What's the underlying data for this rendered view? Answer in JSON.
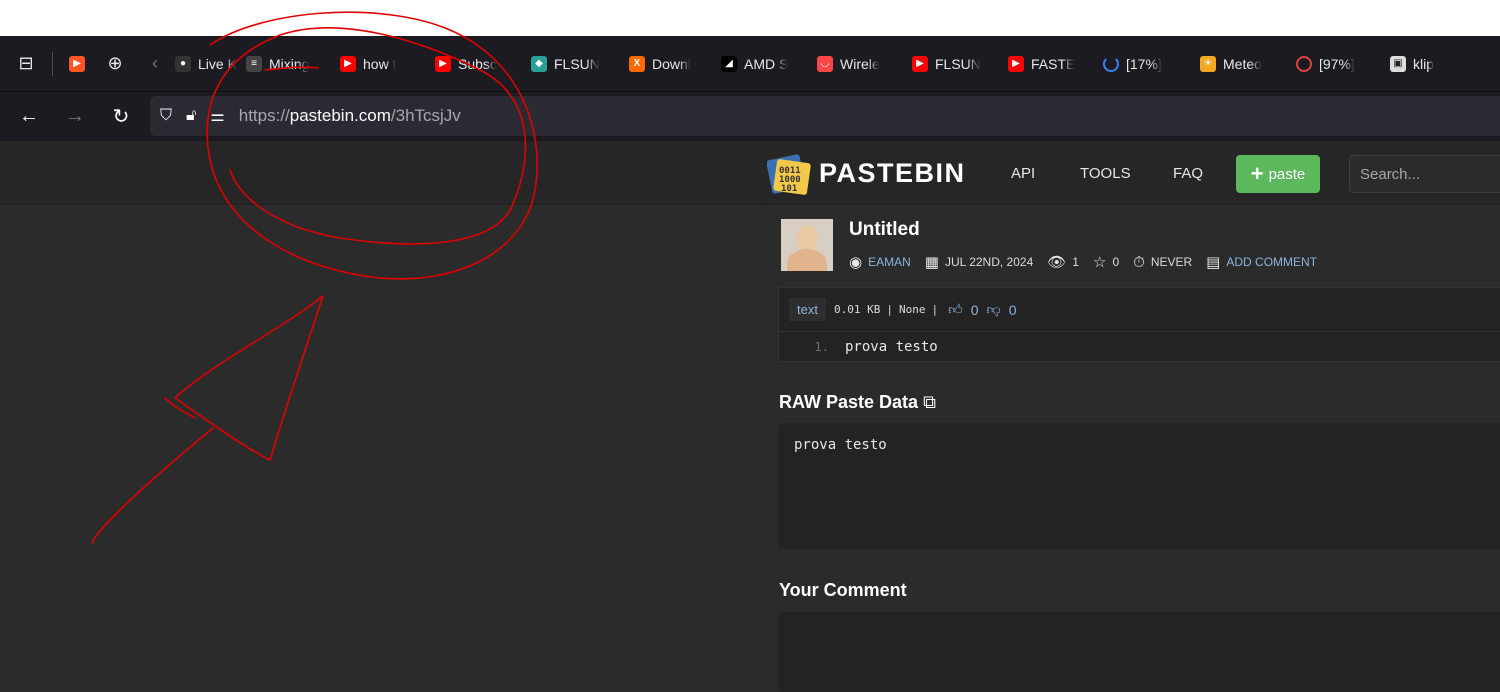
{
  "browser": {
    "tabs": [
      {
        "label": "Live K",
        "icon": "livekit-icon",
        "color": "#333333"
      },
      {
        "label": "Mixing",
        "icon": "mixing-icon",
        "color": "#444444"
      },
      {
        "label": "how t",
        "icon": "youtube-icon",
        "color": "#ff0000"
      },
      {
        "label": "Subsc",
        "icon": "youtube-icon",
        "color": "#ff0000"
      },
      {
        "label": "FLSUN",
        "icon": "flsun-icon",
        "color": "#2aa198"
      },
      {
        "label": "Downl",
        "icon": "x-icon",
        "color": "#ff6a00"
      },
      {
        "label": "AMD S",
        "icon": "amd-icon",
        "color": "#000000"
      },
      {
        "label": "Wirele",
        "icon": "aliexpress-icon",
        "color": "#ff4747"
      },
      {
        "label": "FLSUN",
        "icon": "youtube-icon",
        "color": "#ff0000"
      },
      {
        "label": "FASTE",
        "icon": "youtube-icon",
        "color": "#ff0000"
      },
      {
        "label": "[17%]",
        "icon": "loading-spinner-icon",
        "color": "#3b82f6"
      },
      {
        "label": "Meteo",
        "icon": "meteo-icon",
        "color": "#f5a623"
      },
      {
        "label": "[97%]",
        "icon": "loading-ring-icon",
        "color": "#e0433b"
      },
      {
        "label": "klip",
        "icon": "klip-icon",
        "color": "#dddddd"
      }
    ],
    "url_prefix": "https://",
    "url_domain": "pastebin.com",
    "url_path": "/3hTcsjJv"
  },
  "site": {
    "logo_text": "PASTEBIN",
    "nav": [
      "API",
      "TOOLS",
      "FAQ"
    ],
    "paste_button": "paste",
    "search_placeholder": "Search..."
  },
  "paste": {
    "title": "Untitled",
    "author": "EAMAN",
    "date": "JUL 22ND, 2024",
    "views": "1",
    "stars": "0",
    "expiry": "NEVER",
    "add_comment": "ADD COMMENT",
    "syntax": "text",
    "size": "0.01 KB",
    "category": "None",
    "likes": "0",
    "dislikes": "0",
    "lines": [
      {
        "num": "1.",
        "code": "prova testo"
      }
    ],
    "raw_heading": "RAW Paste Data",
    "raw_content": "prova testo",
    "comment_heading": "Your Comment"
  },
  "colors": {
    "accent_green": "#5cb85c",
    "link_blue": "#8bb4e0",
    "annotation_red": "#e00000"
  }
}
